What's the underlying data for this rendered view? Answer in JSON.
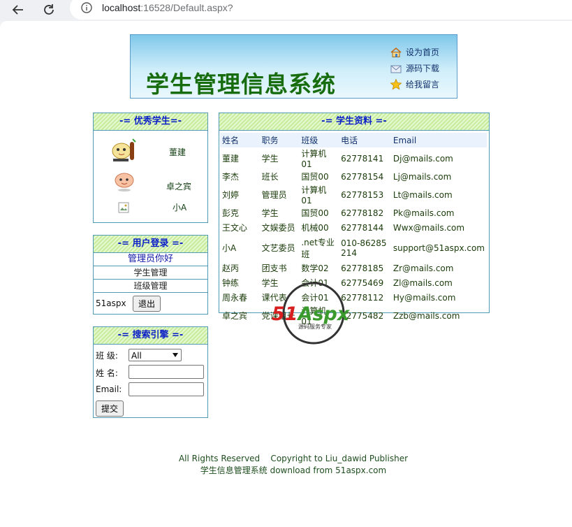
{
  "browser": {
    "url_host": "localhost",
    "url_rest": ":16528/Default.aspx?"
  },
  "banner": {
    "title": "学生管理信息系统",
    "links": [
      "设为首页",
      "源码下载",
      "给我留言"
    ]
  },
  "excellent": {
    "heading": "-= 优秀学生=-",
    "students": [
      "董建",
      "卓之宾",
      "小A"
    ]
  },
  "login": {
    "heading": "-= 用户登录 =-",
    "greeting": "管理员你好",
    "item1": "学生管理",
    "item2": "班级管理",
    "user": "51aspx",
    "logout": "退出"
  },
  "search": {
    "heading": "-= 搜索引擎 =-",
    "class_label": "班 级:",
    "class_value": "All",
    "name_label": "姓 名:",
    "email_label": "Email:",
    "submit": "提交"
  },
  "students": {
    "heading": "-= 学生资料 =-",
    "columns": [
      "姓名",
      "职务",
      "班级",
      "电话",
      "Email"
    ],
    "rows": [
      [
        "董建",
        "学生",
        "计算机01",
        "62778141",
        "Dj@mails.com"
      ],
      [
        "李杰",
        "班长",
        "国贸00",
        "62778154",
        "Lj@mails.com"
      ],
      [
        "刘婷",
        "管理员",
        "计算机01",
        "62778153",
        "Lt@mails.com"
      ],
      [
        "彭克",
        "学生",
        "国贸00",
        "62778182",
        "Pk@mails.com"
      ],
      [
        "王文心",
        "文娱委员",
        "机械00",
        "62778144",
        "Wwx@mails.com"
      ],
      [
        "小A",
        "文艺委员",
        ".net专业班",
        "010-86285214",
        "support@51aspx.com"
      ],
      [
        "赵丙",
        "团支书",
        "数学02",
        "62778185",
        "Zr@mails.com"
      ],
      [
        "钟练",
        "学生",
        "会计01",
        "62775469",
        "Zl@mails.com"
      ],
      [
        "周永春",
        "课代表",
        "会计01",
        "62778112",
        "Hy@mails.com"
      ],
      [
        "卓之宾",
        "党课组长",
        "计算机01",
        "62775482",
        "Zzb@mails.com"
      ]
    ]
  },
  "watermark": {
    "brand": "51Aspx",
    "tagline": "源码服务专家"
  },
  "footer": {
    "line1": "All Rights Reserved    Copyright to Liu_dawid Publisher",
    "line2": "学生信息管理系统 download from 51aspx.com"
  },
  "colors": {
    "banner_title": "#176d0e",
    "box_border": "#4f9bb4",
    "heading_text": "#0b1fc8"
  }
}
